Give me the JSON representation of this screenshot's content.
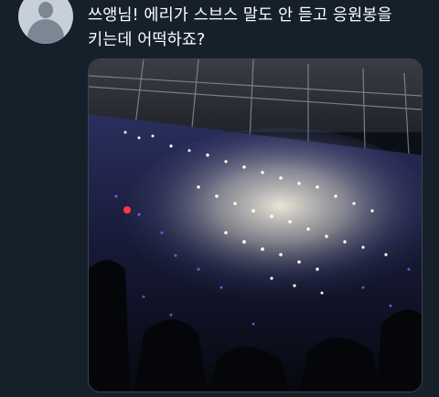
{
  "tweet": {
    "text": "쓰앵님! 에리가 스브스 말도 안 듣고 응원봉을 키는데 어떡하죠?",
    "avatar_icon": "default-profile-icon",
    "media_description_icon": "stadium-photo"
  },
  "colors": {
    "background": "#15202b",
    "text": "#ffffff",
    "media_border": "#38444d"
  }
}
